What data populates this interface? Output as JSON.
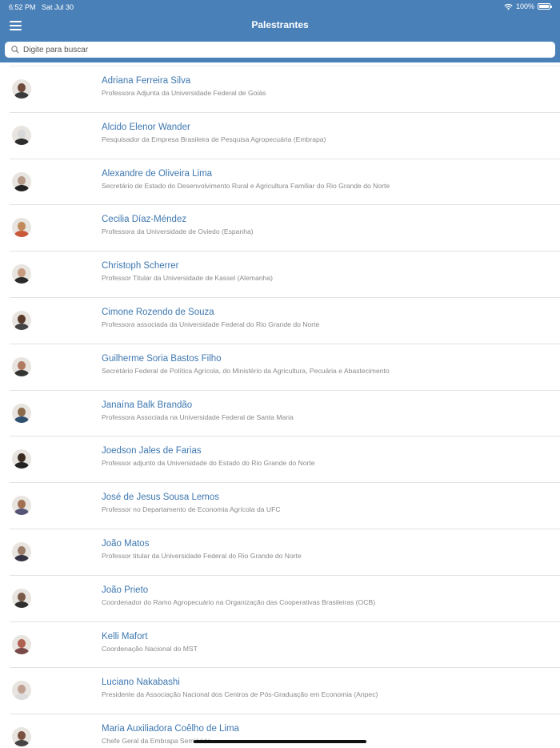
{
  "status_bar": {
    "time": "6:52 PM",
    "date": "Sat Jul 30",
    "battery": "100%"
  },
  "nav": {
    "title": "Palestrantes"
  },
  "search": {
    "placeholder": "Digite para buscar"
  },
  "speakers": [
    {
      "name": "Adriana Ferreira Silva",
      "role": "Professora Adjunta da Universidade Federal de Goiás"
    },
    {
      "name": "Alcido Elenor Wander",
      "role": "Pesquisador da Empresa Brasileira de Pesquisa Agropecuária (Embrapa)"
    },
    {
      "name": "Alexandre de Oliveira Lima",
      "role": "Secretário de Estado do Desenvolvimento Rural e Agricultura Familiar do Rio Grande do Norte"
    },
    {
      "name": "Cecilia Díaz-Méndez",
      "role": "Professora da Universidade de Oviedo (Espanha)"
    },
    {
      "name": "Christoph Scherrer",
      "role": "Professor Titular da Universidade de Kassel (Alemanha)"
    },
    {
      "name": "Cimone Rozendo de Souza",
      "role": "Professora associada da Universidade Federal do Rio Grande do Norte"
    },
    {
      "name": "Guilherme Soria Bastos Filho",
      "role": "Secretário Federal de Política Agrícola, do Ministério da Agricultura, Pecuária e Abastecimento"
    },
    {
      "name": "Janaína Balk Brandão",
      "role": "Professora Associada na Universidade Federal de Santa Maria"
    },
    {
      "name": "Joedson Jales de Farias",
      "role": "Professor adjunto da Universidade do Estado do Rio Grande do Norte"
    },
    {
      "name": "José de Jesus Sousa Lemos",
      "role": "Professor no Departamento de Economia Agrícola da UFC"
    },
    {
      "name": "João Matos",
      "role": "Professor titular da Universidade Federal do Rio Grande do Norte"
    },
    {
      "name": "João Prieto",
      "role": "Coordenador do Ramo Agropecuário na Organização das Cooperativas Brasileiras (OCB)"
    },
    {
      "name": "Kelli Mafort",
      "role": "Coordenação Nacional do MST"
    },
    {
      "name": "Luciano Nakabashi",
      "role": "Presidente da Associação Nacional dos Centros de Pós-Graduação em Economia (Anpec)"
    },
    {
      "name": "Maria Auxiliadora Coêlho de Lima",
      "role": "Chefe Geral da Embrapa Semiárido"
    }
  ],
  "colors": {
    "header": "#4a80b8",
    "name": "#3d77b0",
    "role": "#8a8a8a"
  }
}
